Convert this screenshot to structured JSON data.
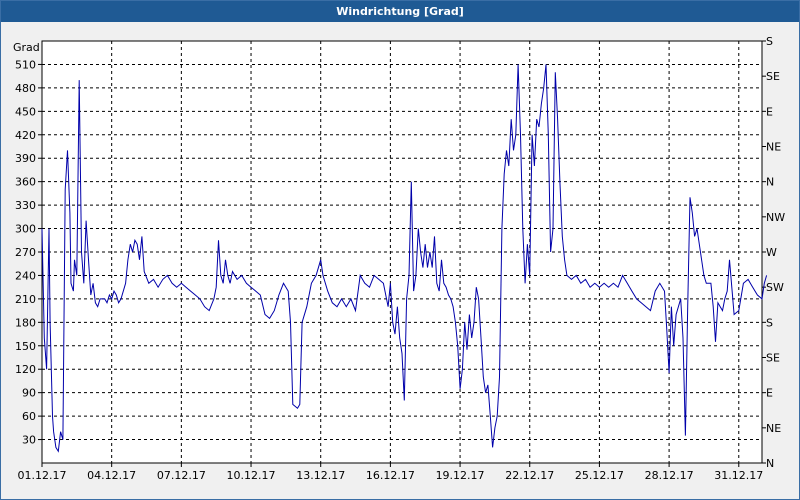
{
  "window": {
    "title": "Windrichtung [Grad]"
  },
  "colors": {
    "titlebar": "#1f5a94",
    "series": "#0000aa",
    "grid": "#000000",
    "plot_bg": "#ffffff"
  },
  "chart_data": {
    "type": "line",
    "title": "Windrichtung [Grad]",
    "ylabel": "Grad",
    "ylim": [
      0,
      540
    ],
    "yticks": [
      30,
      60,
      90,
      120,
      150,
      180,
      210,
      240,
      270,
      300,
      330,
      360,
      390,
      420,
      450,
      480,
      510
    ],
    "y2_ticks": [
      {
        "value": 0,
        "label": "N"
      },
      {
        "value": 45,
        "label": "NE"
      },
      {
        "value": 90,
        "label": "E"
      },
      {
        "value": 135,
        "label": "SE"
      },
      {
        "value": 180,
        "label": "S"
      },
      {
        "value": 225,
        "label": "SW"
      },
      {
        "value": 270,
        "label": "W"
      },
      {
        "value": 315,
        "label": "NW"
      },
      {
        "value": 360,
        "label": "N"
      },
      {
        "value": 405,
        "label": "NE"
      },
      {
        "value": 450,
        "label": "E"
      },
      {
        "value": 495,
        "label": "SE"
      },
      {
        "value": 540,
        "label": "S"
      }
    ],
    "xlim": [
      0,
      31
    ],
    "xticks": [
      {
        "day": 0,
        "label": "01.12.17"
      },
      {
        "day": 3,
        "label": "04.12.17"
      },
      {
        "day": 6,
        "label": "07.12.17"
      },
      {
        "day": 9,
        "label": "10.12.17"
      },
      {
        "day": 12,
        "label": "13.12.17"
      },
      {
        "day": 15,
        "label": "16.12.17"
      },
      {
        "day": 18,
        "label": "19.12.17"
      },
      {
        "day": 21,
        "label": "22.12.17"
      },
      {
        "day": 24,
        "label": "25.12.17"
      },
      {
        "day": 27,
        "label": "28.12.17"
      },
      {
        "day": 30,
        "label": "31.12.17"
      }
    ],
    "grid": true,
    "series": [
      {
        "values": [
          [
            0.0,
            300
          ],
          [
            0.1,
            160
          ],
          [
            0.2,
            120
          ],
          [
            0.3,
            300
          ],
          [
            0.35,
            180
          ],
          [
            0.45,
            60
          ],
          [
            0.5,
            40
          ],
          [
            0.6,
            20
          ],
          [
            0.7,
            15
          ],
          [
            0.8,
            40
          ],
          [
            0.9,
            30
          ],
          [
            1.0,
            350
          ],
          [
            1.1,
            400
          ],
          [
            1.2,
            320
          ],
          [
            1.25,
            230
          ],
          [
            1.35,
            220
          ],
          [
            1.4,
            260
          ],
          [
            1.5,
            240
          ],
          [
            1.6,
            490
          ],
          [
            1.7,
            270
          ],
          [
            1.8,
            230
          ],
          [
            1.9,
            310
          ],
          [
            2.0,
            260
          ],
          [
            2.1,
            215
          ],
          [
            2.2,
            230
          ],
          [
            2.3,
            205
          ],
          [
            2.4,
            200
          ],
          [
            2.5,
            210
          ],
          [
            2.6,
            210
          ],
          [
            2.7,
            210
          ],
          [
            2.8,
            205
          ],
          [
            2.9,
            215
          ],
          [
            3.0,
            210
          ],
          [
            3.1,
            220
          ],
          [
            3.2,
            215
          ],
          [
            3.3,
            205
          ],
          [
            3.4,
            210
          ],
          [
            3.6,
            230
          ],
          [
            3.7,
            260
          ],
          [
            3.8,
            280
          ],
          [
            3.9,
            270
          ],
          [
            4.0,
            285
          ],
          [
            4.1,
            280
          ],
          [
            4.2,
            260
          ],
          [
            4.3,
            290
          ],
          [
            4.4,
            245
          ],
          [
            4.6,
            230
          ],
          [
            4.8,
            235
          ],
          [
            5.0,
            225
          ],
          [
            5.2,
            235
          ],
          [
            5.4,
            240
          ],
          [
            5.6,
            230
          ],
          [
            5.8,
            225
          ],
          [
            6.0,
            230
          ],
          [
            6.2,
            225
          ],
          [
            6.4,
            220
          ],
          [
            6.6,
            215
          ],
          [
            6.8,
            210
          ],
          [
            7.0,
            200
          ],
          [
            7.2,
            195
          ],
          [
            7.4,
            210
          ],
          [
            7.5,
            225
          ],
          [
            7.6,
            285
          ],
          [
            7.7,
            240
          ],
          [
            7.8,
            230
          ],
          [
            7.9,
            260
          ],
          [
            8.0,
            240
          ],
          [
            8.1,
            230
          ],
          [
            8.2,
            245
          ],
          [
            8.4,
            235
          ],
          [
            8.6,
            240
          ],
          [
            8.8,
            230
          ],
          [
            9.0,
            225
          ],
          [
            9.2,
            220
          ],
          [
            9.4,
            215
          ],
          [
            9.6,
            190
          ],
          [
            9.8,
            185
          ],
          [
            10.0,
            195
          ],
          [
            10.2,
            215
          ],
          [
            10.4,
            230
          ],
          [
            10.6,
            220
          ],
          [
            10.7,
            180
          ],
          [
            10.8,
            75
          ],
          [
            11.0,
            70
          ],
          [
            11.1,
            75
          ],
          [
            11.2,
            180
          ],
          [
            11.4,
            200
          ],
          [
            11.6,
            230
          ],
          [
            11.8,
            240
          ],
          [
            12.0,
            260
          ],
          [
            12.1,
            240
          ],
          [
            12.3,
            220
          ],
          [
            12.5,
            205
          ],
          [
            12.7,
            200
          ],
          [
            12.9,
            210
          ],
          [
            13.1,
            200
          ],
          [
            13.3,
            210
          ],
          [
            13.5,
            195
          ],
          [
            13.7,
            240
          ],
          [
            13.9,
            230
          ],
          [
            14.1,
            225
          ],
          [
            14.3,
            240
          ],
          [
            14.5,
            235
          ],
          [
            14.7,
            230
          ],
          [
            14.9,
            200
          ],
          [
            15.0,
            230
          ],
          [
            15.1,
            180
          ],
          [
            15.2,
            165
          ],
          [
            15.3,
            200
          ],
          [
            15.4,
            160
          ],
          [
            15.5,
            140
          ],
          [
            15.6,
            80
          ],
          [
            15.7,
            210
          ],
          [
            15.8,
            240
          ],
          [
            15.9,
            360
          ],
          [
            16.0,
            220
          ],
          [
            16.1,
            240
          ],
          [
            16.2,
            300
          ],
          [
            16.3,
            270
          ],
          [
            16.4,
            250
          ],
          [
            16.5,
            280
          ],
          [
            16.6,
            250
          ],
          [
            16.7,
            270
          ],
          [
            16.8,
            250
          ],
          [
            16.9,
            290
          ],
          [
            17.0,
            230
          ],
          [
            17.1,
            220
          ],
          [
            17.2,
            260
          ],
          [
            17.3,
            230
          ],
          [
            17.4,
            225
          ],
          [
            17.5,
            215
          ],
          [
            17.6,
            210
          ],
          [
            17.7,
            200
          ],
          [
            17.8,
            180
          ],
          [
            17.9,
            150
          ],
          [
            18.0,
            95
          ],
          [
            18.1,
            120
          ],
          [
            18.2,
            180
          ],
          [
            18.3,
            145
          ],
          [
            18.4,
            190
          ],
          [
            18.5,
            160
          ],
          [
            18.6,
            180
          ],
          [
            18.7,
            225
          ],
          [
            18.8,
            210
          ],
          [
            18.9,
            160
          ],
          [
            19.0,
            110
          ],
          [
            19.1,
            90
          ],
          [
            19.2,
            100
          ],
          [
            19.3,
            60
          ],
          [
            19.4,
            20
          ],
          [
            19.5,
            45
          ],
          [
            19.6,
            60
          ],
          [
            19.7,
            110
          ],
          [
            19.8,
            300
          ],
          [
            19.9,
            370
          ],
          [
            20.0,
            400
          ],
          [
            20.1,
            380
          ],
          [
            20.2,
            440
          ],
          [
            20.3,
            400
          ],
          [
            20.4,
            420
          ],
          [
            20.5,
            510
          ],
          [
            20.6,
            420
          ],
          [
            20.7,
            300
          ],
          [
            20.8,
            230
          ],
          [
            20.9,
            280
          ],
          [
            21.0,
            240
          ],
          [
            21.1,
            420
          ],
          [
            21.2,
            380
          ],
          [
            21.3,
            440
          ],
          [
            21.4,
            430
          ],
          [
            21.5,
            460
          ],
          [
            21.6,
            480
          ],
          [
            21.7,
            510
          ],
          [
            21.8,
            420
          ],
          [
            21.9,
            270
          ],
          [
            22.0,
            300
          ],
          [
            22.1,
            500
          ],
          [
            22.2,
            440
          ],
          [
            22.3,
            360
          ],
          [
            22.4,
            290
          ],
          [
            22.5,
            260
          ],
          [
            22.6,
            240
          ],
          [
            22.8,
            235
          ],
          [
            23.0,
            240
          ],
          [
            23.2,
            230
          ],
          [
            23.4,
            235
          ],
          [
            23.6,
            225
          ],
          [
            23.8,
            230
          ],
          [
            24.0,
            225
          ],
          [
            24.2,
            230
          ],
          [
            24.4,
            225
          ],
          [
            24.6,
            230
          ],
          [
            24.8,
            225
          ],
          [
            25.0,
            240
          ],
          [
            25.2,
            230
          ],
          [
            25.4,
            220
          ],
          [
            25.6,
            210
          ],
          [
            25.8,
            205
          ],
          [
            26.0,
            200
          ],
          [
            26.2,
            195
          ],
          [
            26.4,
            220
          ],
          [
            26.6,
            230
          ],
          [
            26.8,
            220
          ],
          [
            26.9,
            170
          ],
          [
            27.0,
            115
          ],
          [
            27.1,
            200
          ],
          [
            27.2,
            150
          ],
          [
            27.3,
            190
          ],
          [
            27.5,
            210
          ],
          [
            27.6,
            160
          ],
          [
            27.7,
            35
          ],
          [
            27.8,
            200
          ],
          [
            27.9,
            340
          ],
          [
            28.0,
            320
          ],
          [
            28.1,
            290
          ],
          [
            28.2,
            300
          ],
          [
            28.3,
            280
          ],
          [
            28.4,
            260
          ],
          [
            28.5,
            240
          ],
          [
            28.6,
            230
          ],
          [
            28.8,
            230
          ],
          [
            28.9,
            200
          ],
          [
            29.0,
            155
          ],
          [
            29.1,
            205
          ],
          [
            29.2,
            200
          ],
          [
            29.3,
            195
          ],
          [
            29.4,
            210
          ],
          [
            29.5,
            220
          ],
          [
            29.6,
            260
          ],
          [
            29.7,
            225
          ],
          [
            29.8,
            190
          ],
          [
            30.0,
            195
          ],
          [
            30.2,
            230
          ],
          [
            30.4,
            235
          ],
          [
            30.6,
            225
          ],
          [
            30.8,
            215
          ],
          [
            31.0,
            210
          ],
          [
            31.1,
            230
          ],
          [
            31.2,
            240
          ]
        ]
      }
    ]
  }
}
